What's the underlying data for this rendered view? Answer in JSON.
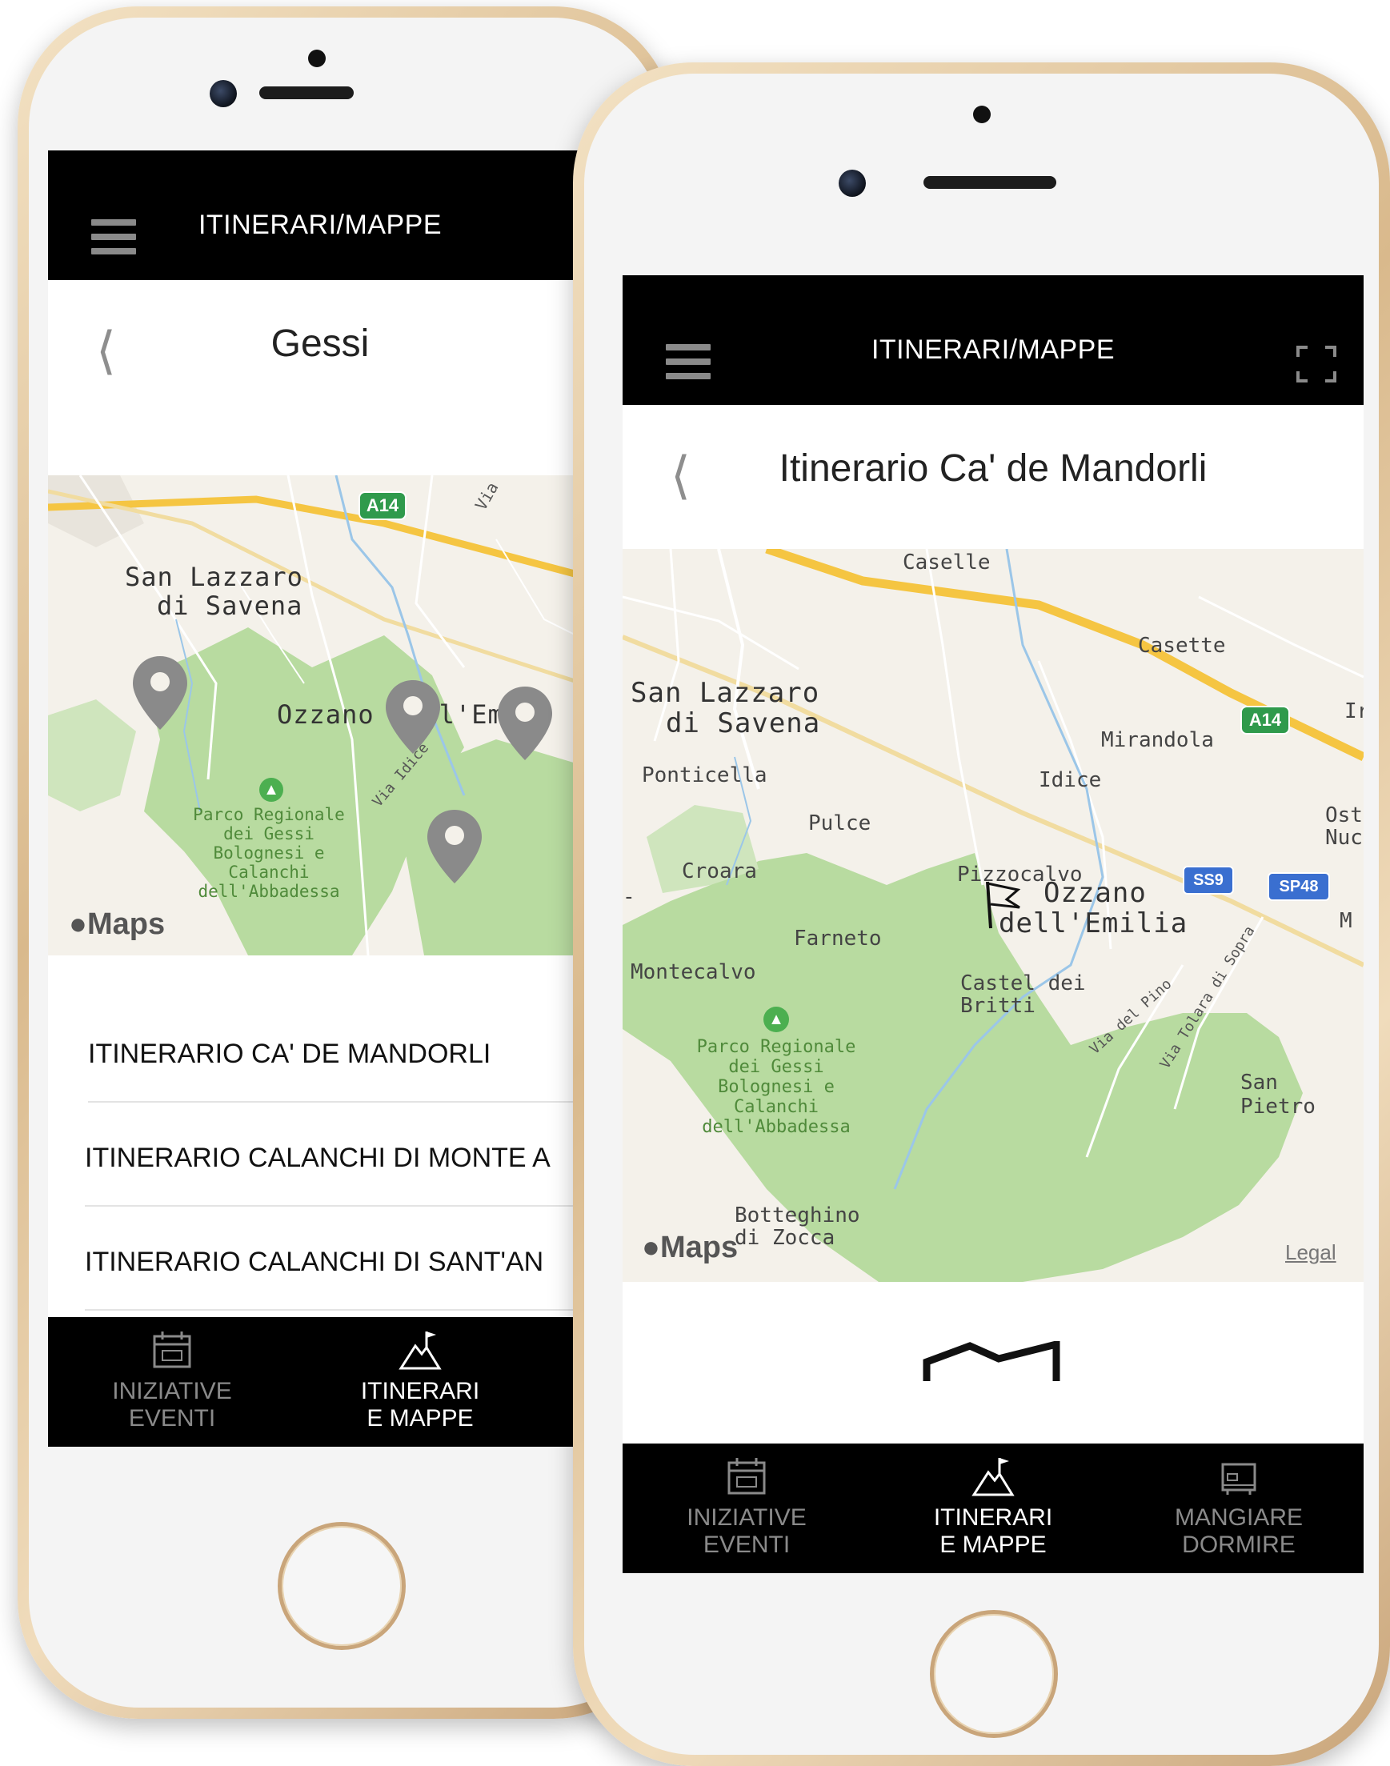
{
  "left_phone": {
    "header_title": "ITINERARI/MAPPE",
    "page_title": "Gessi",
    "map_labels": {
      "city1_line1": "San Lazzaro",
      "city1_line2": "di Savena",
      "city2": "Ozzano dell'Emili",
      "road_a14": "A14",
      "via_label": "Via",
      "via_idice": "Via Idice",
      "park_line1": "Parco Regionale",
      "park_line2": "dei Gessi",
      "park_line3": "Bolognesi e",
      "park_line4": "Calanchi",
      "park_line5": "dell'Abbadessa",
      "maps_brand": "Maps"
    },
    "list_items": [
      "ITINERARIO CA' DE MANDORLI",
      "ITINERARIO CALANCHI DI MONTE A",
      "ITINERARIO CALANCHI DI SANT'AN"
    ],
    "tabs": [
      {
        "line1": "INIZIATIVE",
        "line2": "EVENTI",
        "icon": "calendar-icon"
      },
      {
        "line1": "ITINERARI",
        "line2": "E MAPPE",
        "icon": "mountain-flag-icon"
      }
    ]
  },
  "right_phone": {
    "header_title": "ITINERARI/MAPPE",
    "page_title": "Itinerario Ca' de Mandorli",
    "map_labels": {
      "caselle": "Caselle",
      "casette": "Casette",
      "city1_line1": "San Lazzaro",
      "city1_line2": "di Savena",
      "a14": "A14",
      "edge_ir": "Ir",
      "mirandola": "Mirandola",
      "ponticella": "Ponticella",
      "idice": "Idice",
      "ost_line1": "Ost",
      "ost_line2": "Nuc",
      "pulce": "Pulce",
      "croara": "Croara",
      "pizzocalvo": "Pizzocalvo",
      "ozzano_line1": "Ozzano",
      "ozzano_line2": "dell'Emilia",
      "ss9": "SS9",
      "sp48": "SP48",
      "edge_m": "M",
      "edge_dash": "-",
      "farneto": "Farneto",
      "montecalvo": "Montecalvo",
      "castel_line1": "Castel dei",
      "castel_line2": "Britti",
      "via_del_pino": "Via del Pino",
      "via_tolara": "Via Tolara di Sopra",
      "san_pietro": "San Pietro",
      "park_line1": "Parco Regionale",
      "park_line2": "dei Gessi",
      "park_line3": "Bolognesi e",
      "park_line4": "Calanchi",
      "park_line5": "dell'Abbadessa",
      "botteghino_line1": "Botteghino",
      "botteghino_line2": "di Zocca",
      "maps_brand": "Maps",
      "legal": "Legal"
    },
    "tabs": [
      {
        "line1": "INIZIATIVE",
        "line2": "EVENTI",
        "icon": "calendar-icon"
      },
      {
        "line1": "ITINERARI",
        "line2": "E MAPPE",
        "icon": "mountain-flag-icon"
      },
      {
        "line1": "MANGIARE",
        "line2": "DORMIRE",
        "icon": "bed-icon"
      }
    ]
  },
  "colors": {
    "bar_black": "#000000",
    "park_green": "#b8dba0",
    "highway_yellow": "#f5c542",
    "road_sign_green": "#2f9a4c",
    "road_sign_blue": "#3a6fd0",
    "pin_gray": "#8a8a8a",
    "gold_frame": "#d9b98c"
  }
}
